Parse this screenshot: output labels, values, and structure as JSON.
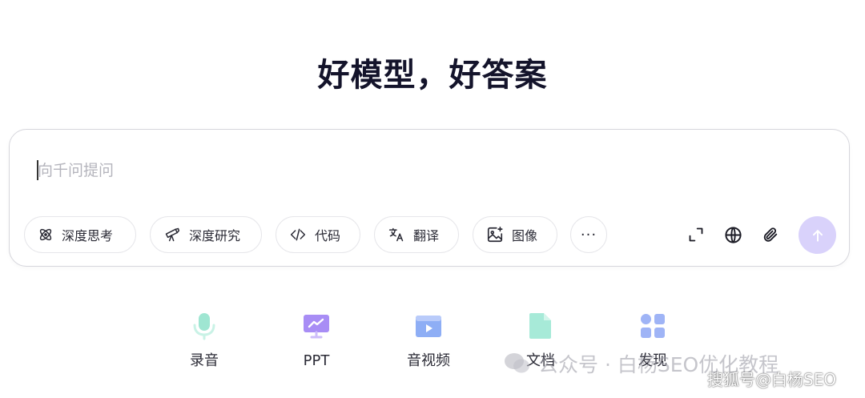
{
  "headline": "好模型，好答案",
  "composer": {
    "placeholder": "向千问提问",
    "tools": [
      {
        "label": "深度思考",
        "icon": "atom-icon"
      },
      {
        "label": "深度研究",
        "icon": "telescope-icon"
      },
      {
        "label": "代码",
        "icon": "code-icon"
      },
      {
        "label": "翻译",
        "icon": "translate-icon"
      },
      {
        "label": "图像",
        "icon": "image-sparkle-icon"
      }
    ],
    "more_label": "···",
    "actions": [
      "expand-icon",
      "globe-icon",
      "paperclip-icon"
    ],
    "send_icon": "arrow-up-icon"
  },
  "shortcuts": [
    {
      "label": "录音",
      "icon": "microphone-icon",
      "color": "#9fe6d2"
    },
    {
      "label": "PPT",
      "icon": "presentation-icon",
      "color": "#a88df5"
    },
    {
      "label": "音视频",
      "icon": "video-player-icon",
      "color": "#8eaef5"
    },
    {
      "label": "文档",
      "icon": "document-icon",
      "color": "#a7ead8"
    },
    {
      "label": "发现",
      "icon": "grid-apps-icon",
      "color": "#9fb4f6"
    }
  ],
  "watermarks": {
    "wechat": "公众号 · 白杨SEO优化教程",
    "sohu": "搜狐号@白杨SEO"
  },
  "colors": {
    "send_button": "#d9d2fb",
    "border": "#d6d6dc",
    "title": "#14142b"
  }
}
